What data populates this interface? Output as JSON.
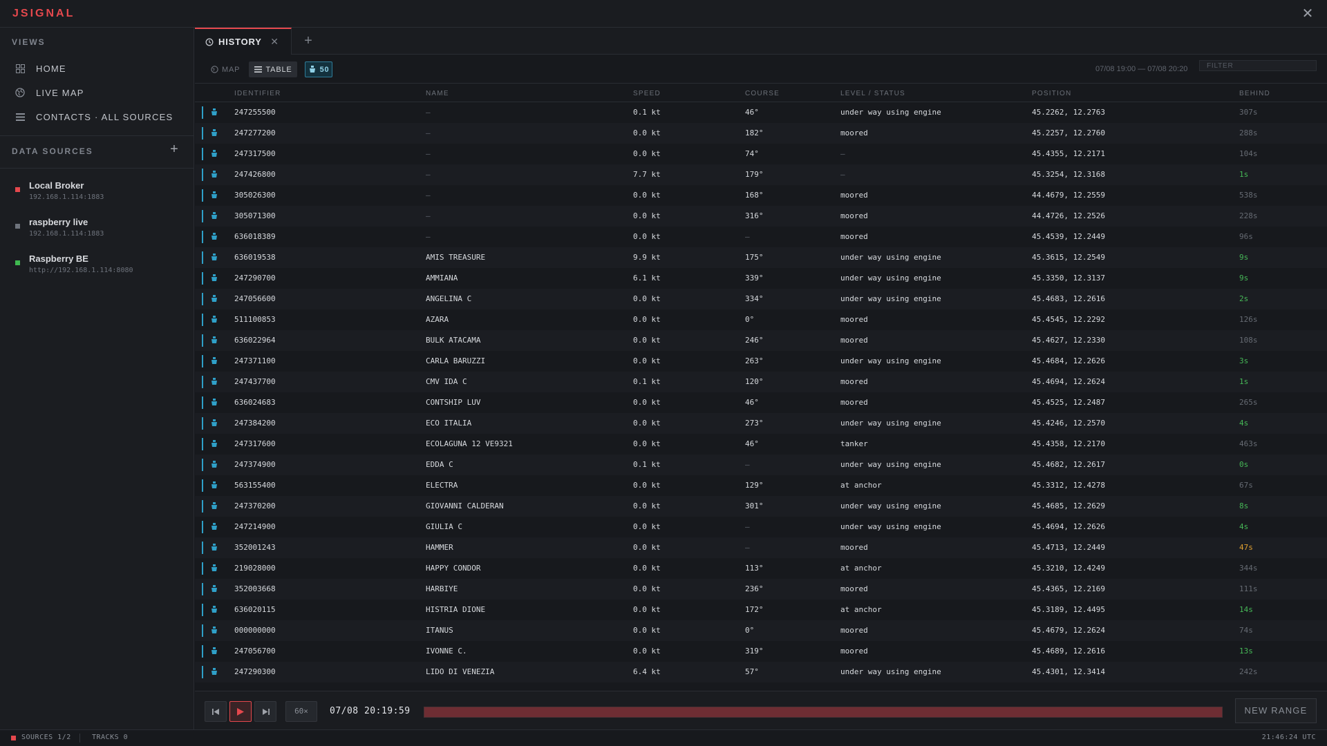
{
  "app": {
    "logo": "JSIGNAL"
  },
  "sidebar": {
    "views_heading": "VIEWS",
    "nav": [
      {
        "label": "HOME",
        "icon": "grid-icon"
      },
      {
        "label": "LIVE MAP",
        "icon": "globe-icon"
      },
      {
        "label": "CONTACTS · ALL SOURCES",
        "icon": "list-icon"
      }
    ],
    "data_sources_heading": "DATA SOURCES",
    "sources": [
      {
        "name": "Local Broker",
        "address": "192.168.1.114:1883",
        "status_color": "#e5484d"
      },
      {
        "name": "raspberry live",
        "address": "192.168.1.114:1883",
        "status_color": "#6e737c"
      },
      {
        "name": "Raspberry BE",
        "address": "http://192.168.1.114:8080",
        "status_color": "#3fb950"
      }
    ]
  },
  "tabs": [
    {
      "label": "HISTORY",
      "icon": "history-icon"
    }
  ],
  "toolbar": {
    "map_label": "MAP",
    "table_label": "TABLE",
    "count": "50",
    "range_label": "07/08 19:00 — 07/08 20:20",
    "filter_placeholder": "FILTER"
  },
  "table": {
    "columns": [
      "IDENTIFIER",
      "NAME",
      "SPEED",
      "COURSE",
      "LEVEL / STATUS",
      "POSITION",
      "BEHIND"
    ],
    "rows": [
      {
        "id": "247255500",
        "name": "—",
        "speed": "0.1 kt",
        "course": "46°",
        "status": "under way using engine",
        "position": "45.2262, 12.2763",
        "behind": "307s",
        "behind_state": "stale"
      },
      {
        "id": "247277200",
        "name": "—",
        "speed": "0.0 kt",
        "course": "182°",
        "status": "moored",
        "position": "45.2257, 12.2760",
        "behind": "288s",
        "behind_state": "stale"
      },
      {
        "id": "247317500",
        "name": "—",
        "speed": "0.0 kt",
        "course": "74°",
        "status": "—",
        "position": "45.4355, 12.2171",
        "behind": "104s",
        "behind_state": "stale"
      },
      {
        "id": "247426800",
        "name": "—",
        "speed": "7.7 kt",
        "course": "179°",
        "status": "—",
        "position": "45.3254, 12.3168",
        "behind": "1s",
        "behind_state": "fresh"
      },
      {
        "id": "305026300",
        "name": "—",
        "speed": "0.0 kt",
        "course": "168°",
        "status": "moored",
        "position": "44.4679, 12.2559",
        "behind": "538s",
        "behind_state": "stale"
      },
      {
        "id": "305071300",
        "name": "—",
        "speed": "0.0 kt",
        "course": "316°",
        "status": "moored",
        "position": "44.4726, 12.2526",
        "behind": "228s",
        "behind_state": "stale"
      },
      {
        "id": "636018389",
        "name": "—",
        "speed": "0.0 kt",
        "course": "—",
        "status": "moored",
        "position": "45.4539, 12.2449",
        "behind": "96s",
        "behind_state": "stale"
      },
      {
        "id": "636019538",
        "name": "AMIS TREASURE",
        "speed": "9.9 kt",
        "course": "175°",
        "status": "under way using engine",
        "position": "45.3615, 12.2549",
        "behind": "9s",
        "behind_state": "fresh"
      },
      {
        "id": "247290700",
        "name": "AMMIANA",
        "speed": "6.1 kt",
        "course": "339°",
        "status": "under way using engine",
        "position": "45.3350, 12.3137",
        "behind": "9s",
        "behind_state": "fresh"
      },
      {
        "id": "247056600",
        "name": "ANGELINA C",
        "speed": "0.0 kt",
        "course": "334°",
        "status": "under way using engine",
        "position": "45.4683, 12.2616",
        "behind": "2s",
        "behind_state": "fresh"
      },
      {
        "id": "511100853",
        "name": "AZARA",
        "speed": "0.0 kt",
        "course": "0°",
        "status": "moored",
        "position": "45.4545, 12.2292",
        "behind": "126s",
        "behind_state": "stale"
      },
      {
        "id": "636022964",
        "name": "BULK ATACAMA",
        "speed": "0.0 kt",
        "course": "246°",
        "status": "moored",
        "position": "45.4627, 12.2330",
        "behind": "108s",
        "behind_state": "stale"
      },
      {
        "id": "247371100",
        "name": "CARLA BARUZZI",
        "speed": "0.0 kt",
        "course": "263°",
        "status": "under way using engine",
        "position": "45.4684, 12.2626",
        "behind": "3s",
        "behind_state": "fresh"
      },
      {
        "id": "247437700",
        "name": "CMV IDA C",
        "speed": "0.1 kt",
        "course": "120°",
        "status": "moored",
        "position": "45.4694, 12.2624",
        "behind": "1s",
        "behind_state": "fresh"
      },
      {
        "id": "636024683",
        "name": "CONTSHIP LUV",
        "speed": "0.0 kt",
        "course": "46°",
        "status": "moored",
        "position": "45.4525, 12.2487",
        "behind": "265s",
        "behind_state": "stale"
      },
      {
        "id": "247384200",
        "name": "ECO ITALIA",
        "speed": "0.0 kt",
        "course": "273°",
        "status": "under way using engine",
        "position": "45.4246, 12.2570",
        "behind": "4s",
        "behind_state": "fresh"
      },
      {
        "id": "247317600",
        "name": "ECOLAGUNA 12  VE9321",
        "speed": "0.0 kt",
        "course": "46°",
        "status": "tanker",
        "position": "45.4358, 12.2170",
        "behind": "463s",
        "behind_state": "stale"
      },
      {
        "id": "247374900",
        "name": "EDDA C",
        "speed": "0.1 kt",
        "course": "—",
        "status": "under way using engine",
        "position": "45.4682, 12.2617",
        "behind": "0s",
        "behind_state": "fresh"
      },
      {
        "id": "563155400",
        "name": "ELECTRA",
        "speed": "0.0 kt",
        "course": "129°",
        "status": "at anchor",
        "position": "45.3312, 12.4278",
        "behind": "67s",
        "behind_state": "stale"
      },
      {
        "id": "247370200",
        "name": "GIOVANNI CALDERAN",
        "speed": "0.0 kt",
        "course": "301°",
        "status": "under way using engine",
        "position": "45.4685, 12.2629",
        "behind": "8s",
        "behind_state": "fresh"
      },
      {
        "id": "247214900",
        "name": "GIULIA C",
        "speed": "0.0 kt",
        "course": "—",
        "status": "under way using engine",
        "position": "45.4694, 12.2626",
        "behind": "4s",
        "behind_state": "fresh"
      },
      {
        "id": "352001243",
        "name": "HAMMER",
        "speed": "0.0 kt",
        "course": "—",
        "status": "moored",
        "position": "45.4713, 12.2449",
        "behind": "47s",
        "behind_state": "warn"
      },
      {
        "id": "219028000",
        "name": "HAPPY CONDOR",
        "speed": "0.0 kt",
        "course": "113°",
        "status": "at anchor",
        "position": "45.3210, 12.4249",
        "behind": "344s",
        "behind_state": "stale"
      },
      {
        "id": "352003668",
        "name": "HARBIYE",
        "speed": "0.0 kt",
        "course": "236°",
        "status": "moored",
        "position": "45.4365, 12.2169",
        "behind": "111s",
        "behind_state": "stale"
      },
      {
        "id": "636020115",
        "name": "HISTRIA DIONE",
        "speed": "0.0 kt",
        "course": "172°",
        "status": "at anchor",
        "position": "45.3189, 12.4495",
        "behind": "14s",
        "behind_state": "fresh"
      },
      {
        "id": "000000000",
        "name": "ITANUS",
        "speed": "0.0 kt",
        "course": "0°",
        "status": "moored",
        "position": "45.4679, 12.2624",
        "behind": "74s",
        "behind_state": "stale"
      },
      {
        "id": "247056700",
        "name": "IVONNE C.",
        "speed": "0.0 kt",
        "course": "319°",
        "status": "moored",
        "position": "45.4689, 12.2616",
        "behind": "13s",
        "behind_state": "fresh"
      },
      {
        "id": "247290300",
        "name": "LIDO DI VENEZIA",
        "speed": "6.4 kt",
        "course": "57°",
        "status": "under way using engine",
        "position": "45.4301, 12.3414",
        "behind": "242s",
        "behind_state": "stale"
      }
    ]
  },
  "playback": {
    "speed": "60×",
    "time": "07/08 20:19:59",
    "progress": 1.0,
    "new_range_label": "NEW RANGE"
  },
  "status": {
    "sources": "SOURCES 1/2",
    "tracks": "TRACKS 0",
    "clock": "21:46:24 UTC"
  },
  "colors": {
    "accent": "#e5484d",
    "track_bar": "#2fa0c8",
    "fresh": "#46b857",
    "warn": "#e0a030"
  }
}
